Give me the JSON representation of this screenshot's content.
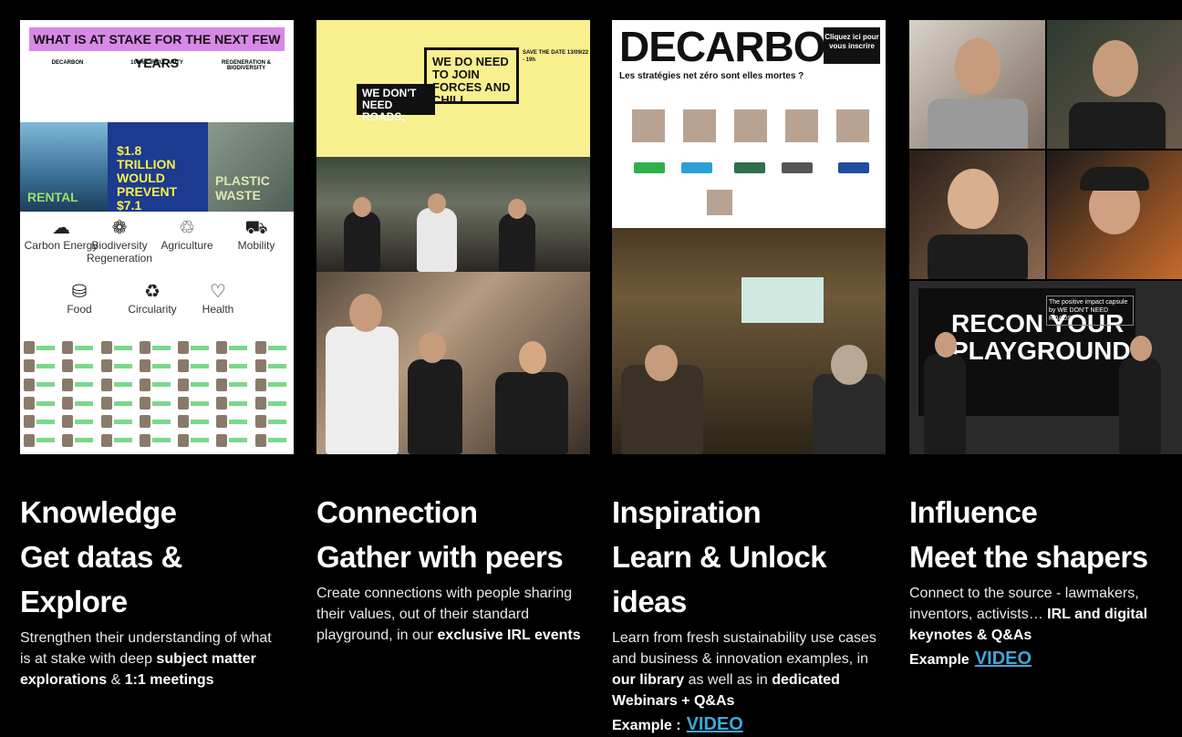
{
  "columns": [
    {
      "heading1": "Knowledge",
      "heading2": "Get datas & Explore",
      "desc_pre": "Strengthen their understanding of what is at stake with deep ",
      "desc_bold1": "subject matter explorations",
      "desc_mid": " & ",
      "desc_bold2": "1:1 meetings",
      "panel": {
        "banner": "WHAT IS AT STAKE FOR THE NEXT FEW YEARS",
        "col_titles": [
          "DECARBON",
          "100% CIRCULARITY",
          "REGENERATION & BIODIVERSITY"
        ],
        "img1_text": "RENTAL",
        "img2_text": "$1.8 TRILLION WOULD PREVENT $7.1 TRILLION",
        "img3_text": "PLASTIC WASTE",
        "categories": [
          "Carbon Energy",
          "Biodiversity Regeneration",
          "Agriculture",
          "Mobility",
          "Food",
          "Circularity",
          "Health"
        ]
      }
    },
    {
      "heading1": "Connection",
      "heading2": "Gather with peers",
      "desc_pre": "Create connections with people sharing their values, out of their standard playground, in our ",
      "desc_bold1": "exclusive IRL events",
      "panel": {
        "box1": "WE DO NEED TO JOIN FORCES AND CHILL.",
        "box2": "WE DON'T NEED ROADS;",
        "save": "SAVE THE DATE 13/09/22 - 19h"
      }
    },
    {
      "heading1": "Inspiration",
      "heading2": "Learn & Unlock ideas",
      "desc_pre": "Learn from fresh sustainability use cases and business & innovation examples, in ",
      "desc_bold1": "our library",
      "desc_mid": " as well as in ",
      "desc_bold2": "dedicated Webinars + Q&As",
      "example_label": "Example :",
      "example_link": "VIDEO",
      "panel": {
        "title": "DECARBON",
        "subtitle": "Les stratégies net zéro sont elles mortes ?",
        "button": "Cliquez ici pour vous inscrire"
      }
    },
    {
      "heading1": "Influence",
      "heading2": "Meet the shapers",
      "desc_pre": "Connect to the source - lawmakers, inventors, activists… ",
      "desc_bold1": "IRL and digital keynotes & Q&As",
      "example_label": "Example",
      "example_link": "VIDEO",
      "panel": {
        "board": "RECON YOUR PLAYGROUND",
        "caption": "The positive impact capsule by WE DON'T NEED ROADS"
      }
    }
  ],
  "colors": {
    "background": "#000000",
    "link": "#3fa7d6",
    "banner": "#d889e6",
    "yellow": "#f8ef8e"
  }
}
